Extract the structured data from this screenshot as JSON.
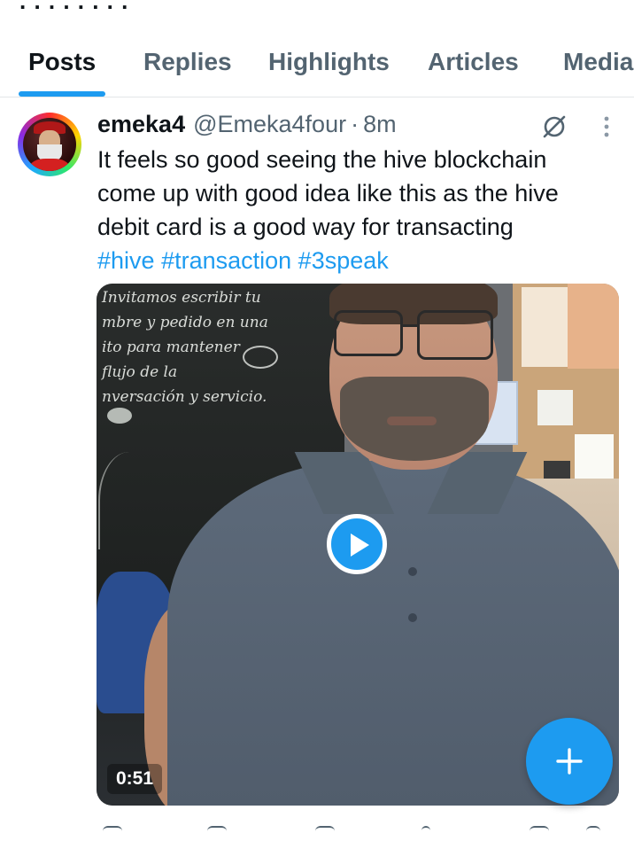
{
  "tabs": [
    {
      "label": "Posts",
      "active": true
    },
    {
      "label": "Replies",
      "active": false
    },
    {
      "label": "Highlights",
      "active": false
    },
    {
      "label": "Articles",
      "active": false
    },
    {
      "label": "Media",
      "active": false
    }
  ],
  "post": {
    "display_name": "emeka4",
    "handle": "@Emeka4four",
    "separator": "·",
    "time": "8m",
    "text": "It feels so good seeing the hive blockchain come up with good idea like this as the hive debit card is a good way for transacting",
    "hashtags": [
      "#hive",
      "#transaction",
      "#3speak"
    ],
    "media": {
      "type": "video",
      "duration": "0:51",
      "chalkboard_text": "Invitamos escribir tu\nmbre y pedido en una\nito para mantener\nflujo de la\nnversación y servicio."
    },
    "icons": {
      "grok": "grok-slash-circle-icon",
      "more": "more-vertical-icon",
      "play": "play-icon"
    }
  },
  "fab": {
    "icon": "plus-icon"
  },
  "colors": {
    "accent": "#1d9bf0",
    "text_primary": "#0f1419",
    "text_secondary": "#536471",
    "divider": "#e3e6e8"
  }
}
